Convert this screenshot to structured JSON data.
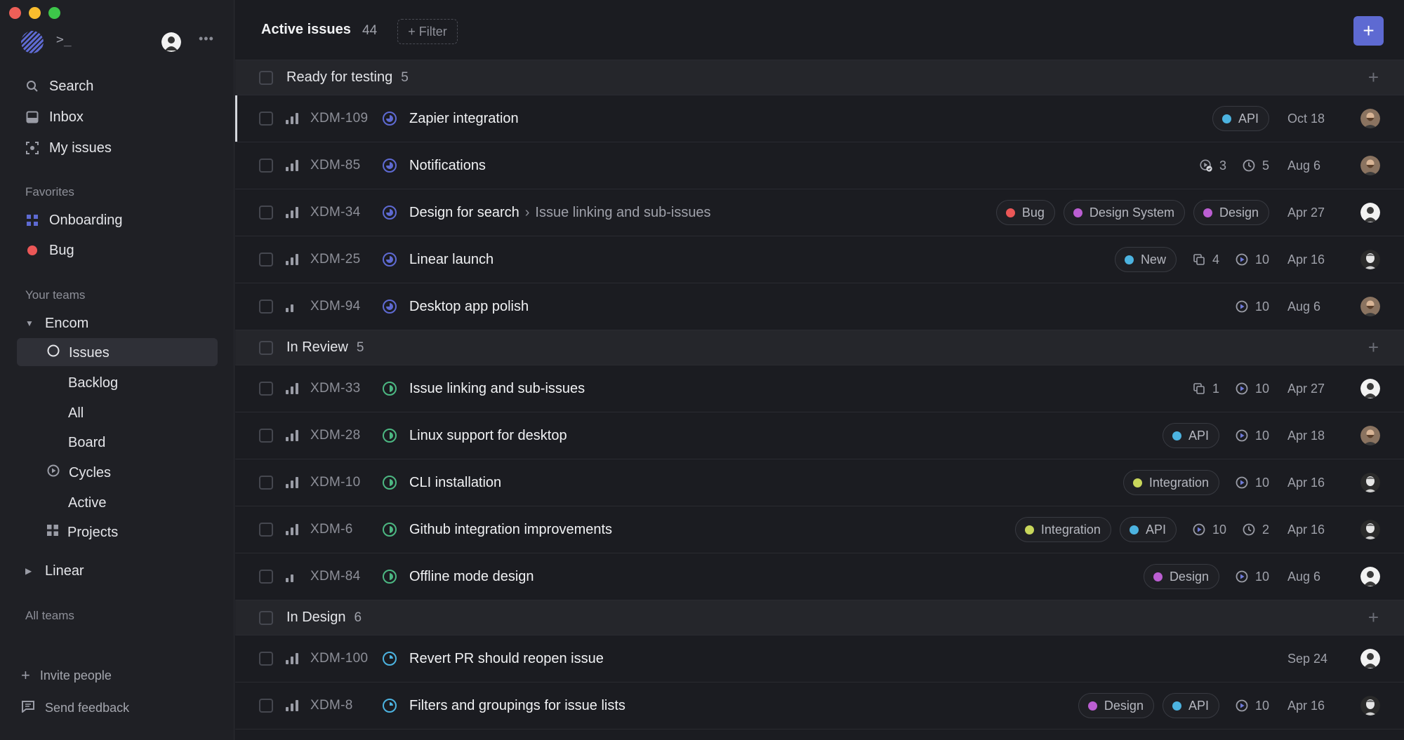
{
  "sidebar": {
    "nav": [
      {
        "label": "Search",
        "icon": "search-icon"
      },
      {
        "label": "Inbox",
        "icon": "inbox-icon"
      },
      {
        "label": "My issues",
        "icon": "my-issues-icon"
      }
    ],
    "favorites_label": "Favorites",
    "favorites": [
      {
        "label": "Onboarding",
        "icon": "grid-icon",
        "color": "#5e6ad2"
      },
      {
        "label": "Bug",
        "icon": "dot-icon",
        "color": "#eb5757"
      }
    ],
    "teams_label": "Your teams",
    "team": {
      "name": "Encom",
      "issues": "Issues",
      "backlog": "Backlog",
      "all": "All",
      "board": "Board",
      "cycles": "Cycles",
      "active": "Active",
      "projects": "Projects"
    },
    "team2": "Linear",
    "all_teams": "All teams",
    "invite": "Invite people",
    "feedback": "Send feedback"
  },
  "header": {
    "title": "Active issues",
    "count": "44",
    "filter_label": "+ Filter",
    "new_label": "+"
  },
  "groups": [
    {
      "name": "Ready for testing",
      "count": "5",
      "status": "review",
      "rows": [
        {
          "id": "XDM-109",
          "title": "Zapier integration",
          "prio": 3,
          "labels": [
            {
              "name": "API",
              "color": "#4cb3e0"
            }
          ],
          "date": "Oct 18",
          "avatar": "bearded"
        },
        {
          "id": "XDM-85",
          "title": "Notifications",
          "prio": 3,
          "stats": [
            {
              "icon": "cycle-check-icon",
              "value": "3"
            },
            {
              "icon": "clock-icon",
              "value": "5"
            }
          ],
          "date": "Aug 6",
          "avatar": "bearded"
        },
        {
          "id": "XDM-34",
          "title": "Design for search",
          "parent": "Issue linking and sub-issues",
          "prio": 3,
          "labels": [
            {
              "name": "Bug",
              "color": "#eb5757"
            },
            {
              "name": "Design System",
              "color": "#bb5ed2"
            },
            {
              "name": "Design",
              "color": "#bb5ed2"
            }
          ],
          "date": "Apr 27",
          "avatar": "light"
        },
        {
          "id": "XDM-25",
          "title": "Linear launch",
          "prio": 3,
          "labels": [
            {
              "name": "New",
              "color": "#4cb3e0"
            }
          ],
          "stats": [
            {
              "icon": "sub-issues-icon",
              "value": "4"
            },
            {
              "icon": "cycle-icon",
              "value": "10"
            }
          ],
          "date": "Apr 16",
          "avatar": "mono"
        },
        {
          "id": "XDM-94",
          "title": "Desktop app polish",
          "prio": 2,
          "stats": [
            {
              "icon": "cycle-icon",
              "value": "10"
            }
          ],
          "date": "Aug 6",
          "avatar": "bearded"
        }
      ]
    },
    {
      "name": "In Review",
      "count": "5",
      "status": "green",
      "rows": [
        {
          "id": "XDM-33",
          "title": "Issue linking and sub-issues",
          "prio": 3,
          "stats": [
            {
              "icon": "sub-issues-icon",
              "value": "1"
            },
            {
              "icon": "cycle-icon",
              "value": "10"
            }
          ],
          "date": "Apr 27",
          "avatar": "light"
        },
        {
          "id": "XDM-28",
          "title": "Linux support for desktop",
          "prio": 3,
          "labels": [
            {
              "name": "API",
              "color": "#4cb3e0"
            }
          ],
          "stats": [
            {
              "icon": "cycle-icon",
              "value": "10"
            }
          ],
          "date": "Apr 18",
          "avatar": "bearded"
        },
        {
          "id": "XDM-10",
          "title": "CLI installation",
          "prio": 3,
          "labels": [
            {
              "name": "Integration",
              "color": "#c8d65b"
            }
          ],
          "stats": [
            {
              "icon": "cycle-icon",
              "value": "10"
            }
          ],
          "date": "Apr 16",
          "avatar": "mono"
        },
        {
          "id": "XDM-6",
          "title": "Github integration improvements",
          "prio": 3,
          "labels": [
            {
              "name": "Integration",
              "color": "#c8d65b"
            },
            {
              "name": "API",
              "color": "#4cb3e0"
            }
          ],
          "stats": [
            {
              "icon": "cycle-icon",
              "value": "10"
            },
            {
              "icon": "clock-icon",
              "value": "2"
            }
          ],
          "date": "Apr 16",
          "avatar": "mono"
        },
        {
          "id": "XDM-84",
          "title": "Offline mode design",
          "prio": 2,
          "labels": [
            {
              "name": "Design",
              "color": "#bb5ed2"
            }
          ],
          "stats": [
            {
              "icon": "cycle-icon",
              "value": "10"
            }
          ],
          "date": "Aug 6",
          "avatar": "light"
        }
      ]
    },
    {
      "name": "In Design",
      "count": "6",
      "status": "design",
      "rows": [
        {
          "id": "XDM-100",
          "title": "Revert PR should reopen issue",
          "prio": 3,
          "date": "Sep 24",
          "avatar": "light"
        },
        {
          "id": "XDM-8",
          "title": "Filters and groupings for issue lists",
          "prio": 3,
          "labels": [
            {
              "name": "Design",
              "color": "#bb5ed2"
            },
            {
              "name": "API",
              "color": "#4cb3e0"
            }
          ],
          "stats": [
            {
              "icon": "cycle-icon",
              "value": "10"
            }
          ],
          "date": "Apr 16",
          "avatar": "mono"
        }
      ]
    }
  ],
  "colors": {
    "accent": "#5e6ad2",
    "review": "#5e6ad2",
    "green": "#4cb782",
    "design": "#4cb3e0"
  }
}
